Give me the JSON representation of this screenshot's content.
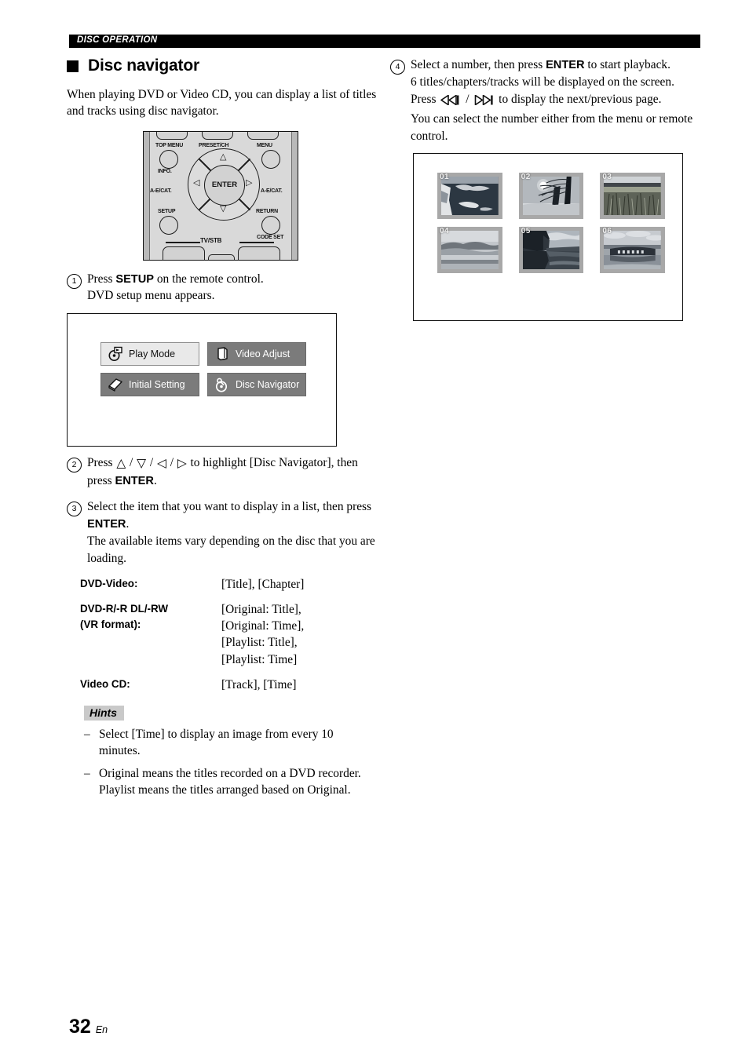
{
  "header": {
    "running_head": "DISC OPERATION"
  },
  "section": {
    "title": "Disc navigator",
    "intro": "When playing DVD or Video CD, you can display a list of titles and tracks using disc navigator."
  },
  "remote": {
    "labels": {
      "top_menu": "TOP MENU",
      "preset_ch": "PRESET/CH",
      "menu": "MENU",
      "info": "INFO.",
      "cat_left": "A-E/CAT.",
      "cat_right": "A-E/CAT.",
      "setup": "SETUP",
      "return": "RETURN",
      "code_set": "CODE SET",
      "tv_stb": "TV/STB",
      "enter": "ENTER"
    }
  },
  "steps": [
    {
      "num": "1",
      "lines": [
        {
          "pre": "Press ",
          "bold": "SETUP",
          "post": " on the remote control."
        },
        {
          "pre": "DVD setup menu appears.",
          "bold": "",
          "post": ""
        }
      ]
    },
    {
      "num": "2",
      "text_pre": "Press ",
      "text_mid": " to highlight [Disc Navigator], then press ",
      "bold": "ENTER",
      "text_post": "."
    },
    {
      "num": "3",
      "line1_pre": "Select the item that you want to display in a list, then press ",
      "bold": "ENTER",
      "line1_post": ".",
      "line2": "The available items vary depending on the disc that you are loading."
    },
    {
      "num": "4",
      "line1_pre": "Select a number, then press ",
      "bold": "ENTER",
      "line1_post": " to start playback.",
      "line2": "6 titles/chapters/tracks will be displayed on the screen.",
      "line3_pre": "Press ",
      "line3_post": " to display the next/previous page.",
      "line4": "You can select the number either from the menu or remote control."
    }
  ],
  "osd_menu": {
    "items": [
      {
        "label": "Play Mode",
        "icon": "play-mode-disc-icon",
        "selected": true
      },
      {
        "label": "Video Adjust",
        "icon": "video-adjust-icon",
        "selected": false
      },
      {
        "label": "Initial Setting",
        "icon": "initial-setting-icon",
        "selected": false
      },
      {
        "label": "Disc Navigator",
        "icon": "disc-navigator-disc-icon",
        "selected": false
      }
    ]
  },
  "disc_types": [
    {
      "term": "DVD-Video:",
      "values": [
        "[Title], [Chapter]"
      ]
    },
    {
      "term": "DVD-R/-R DL/-RW\n(VR format):",
      "term_line1": "DVD-R/-R DL/-RW",
      "term_line2": "(VR format):",
      "values": [
        "[Original: Title],",
        "[Original: Time],",
        "[Playlist: Title],",
        "[Playlist: Time]"
      ]
    },
    {
      "term": "Video CD:",
      "values": [
        "[Track], [Time]"
      ]
    }
  ],
  "hints": {
    "tag": "Hints",
    "items": [
      "Select [Time] to display an image from every 10 minutes.",
      "Original means the titles recorded on a DVD recorder. Playlist means the titles arranged based on Original."
    ],
    "dash": "–"
  },
  "thumbnails": {
    "items": [
      {
        "number": "01",
        "scene": "rocky-coastline"
      },
      {
        "number": "02",
        "scene": "bare-tree-sun"
      },
      {
        "number": "03",
        "scene": "reed-marsh"
      },
      {
        "number": "04",
        "scene": "misty-mountains"
      },
      {
        "number": "05",
        "scene": "cliff-lake-reflection"
      },
      {
        "number": "06",
        "scene": "island-reflection"
      }
    ]
  },
  "footer": {
    "page_number": "32",
    "language": "En"
  },
  "colors": {
    "runhead_bg": "#000000",
    "osd_item_bg": "#7b7b7b",
    "osd_item_selected_bg": "#e9e9e9",
    "thumb_frame": "#a8a8a8",
    "hints_tag_bg": "#c9c9c9",
    "remote_body": "#d9d9d9"
  }
}
